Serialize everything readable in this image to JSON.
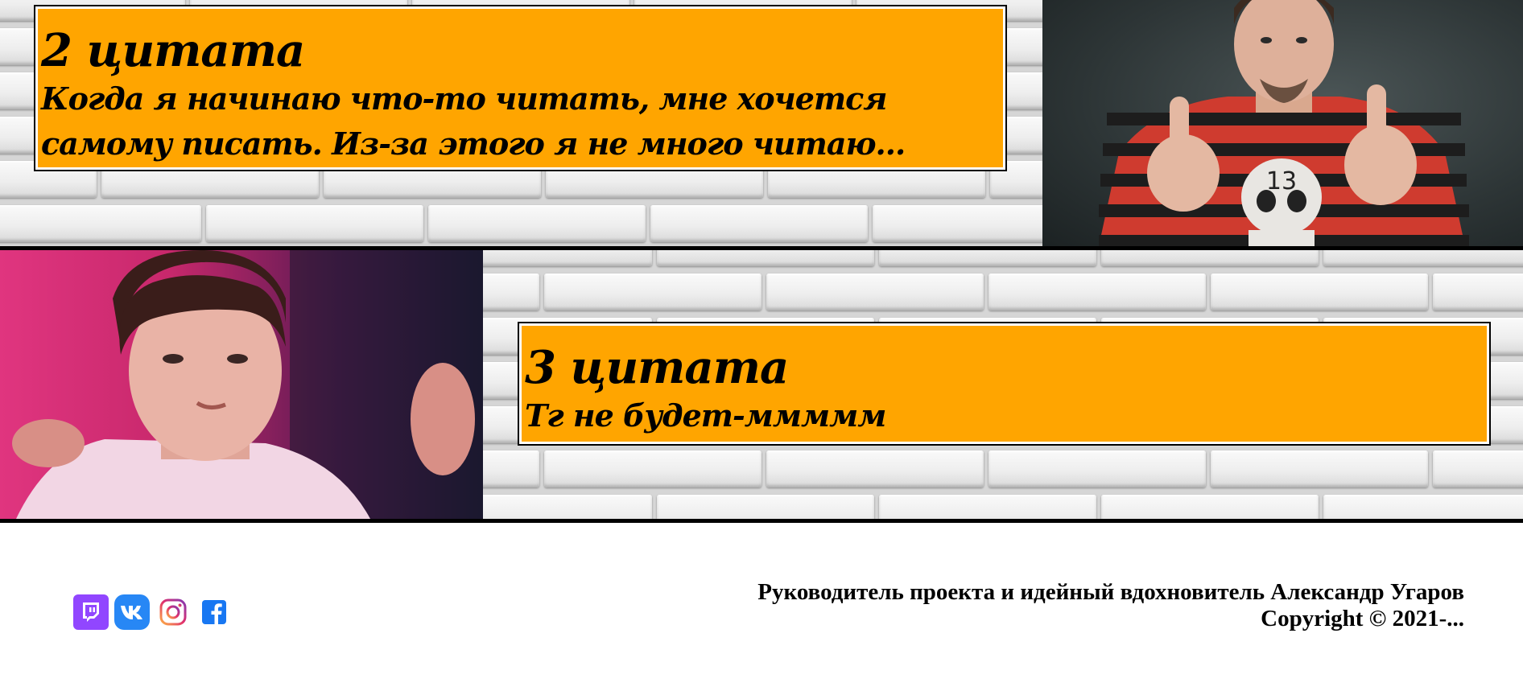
{
  "quotes": [
    {
      "title": "2 цитата",
      "text": "Когда я начинаю что-то читать, мне хочется самому писать. Из-за этого я не много читаю..."
    },
    {
      "title": "3 цитата",
      "text": "Тг не будет-ммммм"
    }
  ],
  "colors": {
    "quote_background": "#ffa500",
    "twitch": "#9146ff",
    "vk": "#2787f5",
    "facebook": "#1877f2"
  },
  "footer": {
    "line1": "Руководитель проекта и идейный вдохновитель Александр Угаров",
    "line2": "Copyright © 2021-..."
  },
  "social_icons": [
    "twitch-icon",
    "vk-icon",
    "instagram-icon",
    "facebook-icon"
  ]
}
